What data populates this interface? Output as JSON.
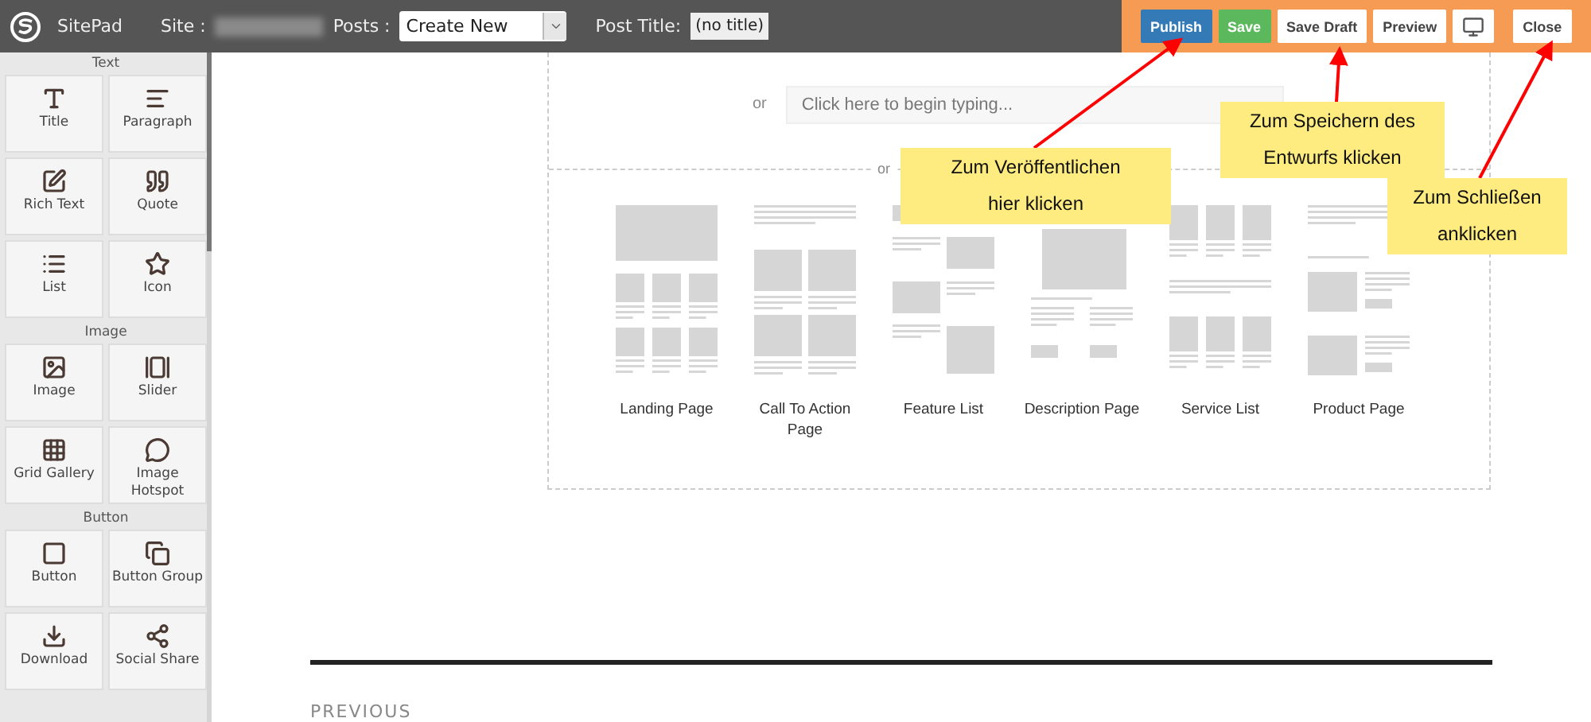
{
  "topbar": {
    "brand": "SitePad",
    "site_label": "Site :",
    "posts_label": "Posts :",
    "posts_value": "Create New",
    "post_title_label": "Post Title:",
    "post_title_value": "(no title)",
    "buttons": [
      {
        "label": "Publish",
        "kind": "primary"
      },
      {
        "label": "Save",
        "kind": "success"
      },
      {
        "label": "Save Draft",
        "kind": "plain"
      },
      {
        "label": "Preview",
        "kind": "plain"
      },
      {
        "kind": "monitor"
      },
      {
        "label": "Close",
        "kind": "plain"
      }
    ]
  },
  "sidebar": {
    "sections": [
      {
        "title": "Text",
        "items": [
          {
            "label": "Title"
          },
          {
            "label": "Paragraph"
          },
          {
            "label": "Rich Text"
          },
          {
            "label": "Quote"
          },
          {
            "label": "List"
          },
          {
            "label": "Icon"
          }
        ]
      },
      {
        "title": "Image",
        "items": [
          {
            "label": "Image"
          },
          {
            "label": "Slider"
          },
          {
            "label": "Grid Gallery"
          },
          {
            "label": "Image Hotspot"
          }
        ]
      },
      {
        "title": "Button",
        "items": [
          {
            "label": "Button"
          },
          {
            "label": "Button Group"
          },
          {
            "label": "Download"
          },
          {
            "label": "Social Share"
          }
        ]
      }
    ]
  },
  "canvas": {
    "or_1": "or",
    "input_placeholder": "Click here to begin typing...",
    "or_2": "or",
    "templates": [
      {
        "label": "Landing Page",
        "kind": "landing"
      },
      {
        "label": "Call To Action Page",
        "kind": "cta"
      },
      {
        "label": "Feature List",
        "kind": "feature"
      },
      {
        "label": "Description Page",
        "kind": "description"
      },
      {
        "label": "Service List",
        "kind": "service"
      },
      {
        "label": "Product Page",
        "kind": "product"
      }
    ],
    "previous": "PREVIOUS"
  },
  "callouts": [
    {
      "lines": [
        "Zum Veröffentlichen",
        "hier klicken"
      ]
    },
    {
      "lines": [
        "Zum Speichern des",
        "Entwurfs klicken"
      ]
    },
    {
      "lines": [
        "Zum Schließen",
        "anklicken"
      ]
    }
  ]
}
